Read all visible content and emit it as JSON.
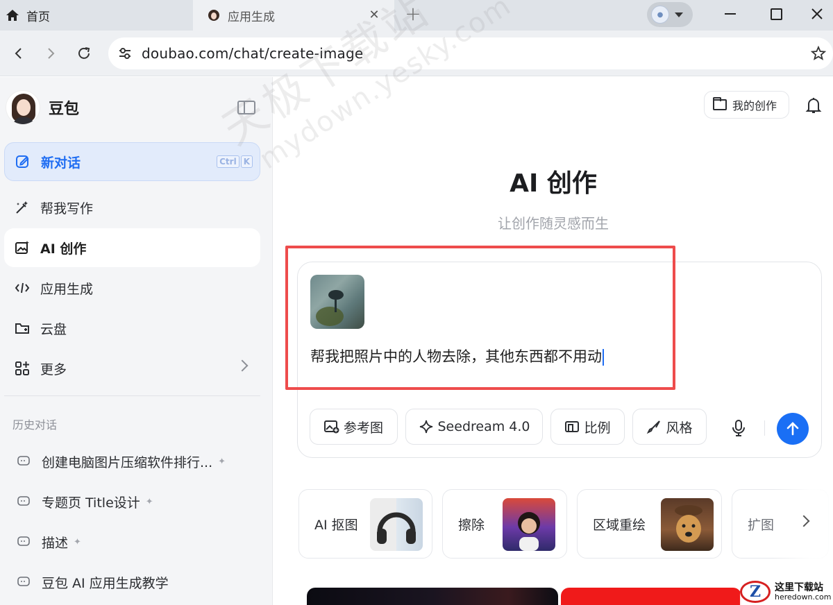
{
  "browser": {
    "tabs": [
      {
        "label": "首页",
        "icon": "home-icon"
      },
      {
        "label": "应用生成",
        "icon": "doubao-favicon"
      }
    ],
    "url": "doubao.com/chat/create-image"
  },
  "sidebar": {
    "brand": "豆包",
    "new_chat": {
      "label": "新对话",
      "shortcut": [
        "Ctrl",
        "K"
      ]
    },
    "items": [
      {
        "label": "帮我写作",
        "icon": "writing-wand-icon"
      },
      {
        "label": "AI 创作",
        "icon": "image-create-icon",
        "active": true
      },
      {
        "label": "应用生成",
        "icon": "code-icon"
      },
      {
        "label": "云盘",
        "icon": "cloud-drive-icon"
      },
      {
        "label": "更多",
        "icon": "grid-more-icon"
      }
    ],
    "history_title": "历史对话",
    "history": [
      {
        "label": "创建电脑图片压缩软件排行...",
        "pinned": true
      },
      {
        "label": "专题页 Title设计",
        "pinned": true
      },
      {
        "label": "描述",
        "pinned": true
      },
      {
        "label": "豆包 AI 应用生成教学",
        "pinned": false
      }
    ]
  },
  "main": {
    "my_creations": "我的创作",
    "title": "AI 创作",
    "subtitle": "让创作随灵感而生",
    "prompt": "帮我把照片中的人物去除，其他东西都不用动",
    "tools": [
      {
        "label": "参考图",
        "icon": "image-add-icon"
      },
      {
        "label": "Seedream 4.0",
        "icon": "sparkle-icon"
      },
      {
        "label": "比例",
        "icon": "ratio-icon"
      },
      {
        "label": "风格",
        "icon": "brush-icon"
      }
    ],
    "cards": [
      {
        "label": "AI 抠图"
      },
      {
        "label": "擦除"
      },
      {
        "label": "区域重绘"
      },
      {
        "label": "扩图"
      }
    ]
  },
  "watermark": {
    "line1": "天极下载站",
    "line2": "mydown.yesky.com"
  },
  "corner_logo": {
    "name": "这里下载站",
    "domain": "heredown.com"
  },
  "colors": {
    "accent": "#1a6ff5",
    "highlight_box": "#ee4c4c",
    "sidebar_bg": "#f4f5f7"
  }
}
